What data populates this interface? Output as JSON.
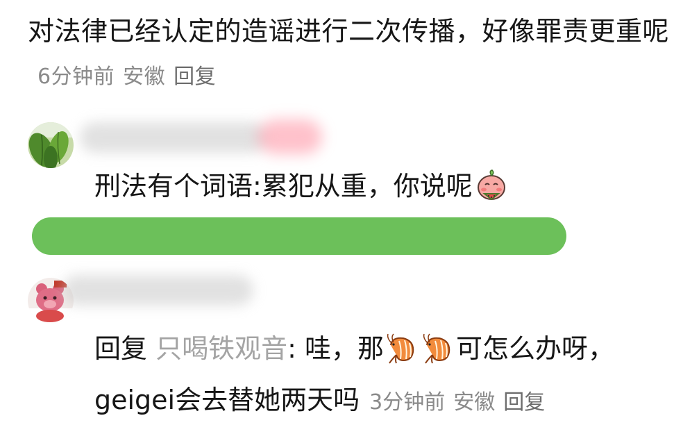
{
  "top_comment": {
    "text": "对法律已经认定的造谣进行二次传播，好像罪责更重呢",
    "time": "6分钟前",
    "location": "安徽",
    "reply_label": "回复"
  },
  "reply_1": {
    "text": "刑法有个词语:累犯从重，你说呢",
    "emoji": "peach-eating-melon-emoji"
  },
  "reply_2": {
    "prefix": "回复",
    "target_user": "只喝铁观音",
    "colon": ":",
    "text_before": " 哇，那",
    "emoji": "shrimp-emoji",
    "text_after": "可怎么办呀，geigei会去替她两天吗",
    "time": "3分钟前",
    "location": "安徽",
    "reply_label": "回复"
  },
  "colors": {
    "meta_gray": "#8a8a8a",
    "reply_target_gray": "#a4a4a4",
    "redaction_green": "#6cc05a"
  }
}
